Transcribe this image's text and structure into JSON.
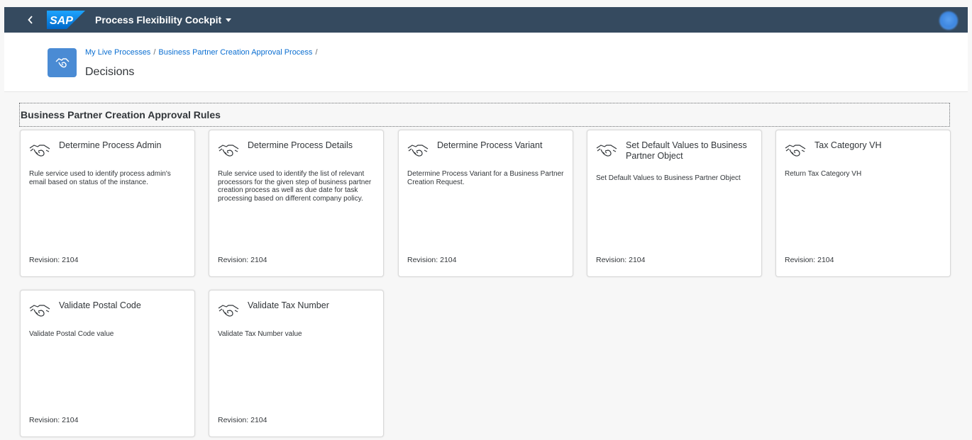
{
  "shell": {
    "logo": "SAP",
    "app_title": "Process Flexibility Cockpit",
    "back_icon": "chevron-left-icon",
    "caret_icon": "caret-down-icon"
  },
  "header": {
    "breadcrumb": [
      "My Live Processes",
      "Business Partner Creation Approval Process"
    ],
    "separator": "/",
    "title": "Decisions",
    "icon": "handshake-icon"
  },
  "section": {
    "title": "Business Partner Creation Approval Rules"
  },
  "cards": [
    {
      "title": "Determine Process Admin",
      "description": "Rule service used to identify process admin's email based on status of the instance.",
      "revision": "Revision: 2104"
    },
    {
      "title": "Determine Process Details",
      "description": "Rule service used to identify the list of relevant processors for the given step of business partner creation process as well as due date for task processing based on different company policy.",
      "revision": "Revision: 2104"
    },
    {
      "title": "Determine Process Variant",
      "description": "Determine Process Variant for a Business Partner Creation Request.",
      "revision": "Revision: 2104"
    },
    {
      "title": "Set Default Values to Business Partner Object",
      "description": "Set Default Values to Business Partner Object",
      "revision": "Revision: 2104"
    },
    {
      "title": "Tax Category VH",
      "description": "Return Tax Category VH",
      "revision": "Revision: 2104"
    },
    {
      "title": "Validate Postal Code",
      "description": "Validate Postal Code value",
      "revision": "Revision: 2104"
    },
    {
      "title": "Validate Tax Number",
      "description": "Validate Tax Number value",
      "revision": "Revision: 2104"
    }
  ],
  "colors": {
    "shellbar": "#354a5f",
    "accent": "#0a6ed1",
    "icon_tile": "#4a8bd4"
  }
}
